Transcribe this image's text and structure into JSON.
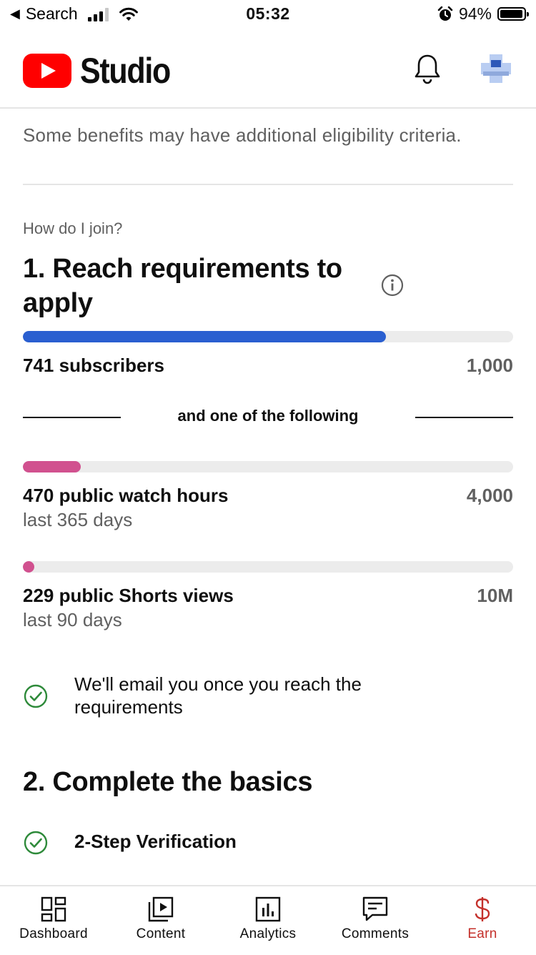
{
  "status_bar": {
    "back_label": "Search",
    "time": "05:32",
    "battery": "94%"
  },
  "app": {
    "name": "Studio"
  },
  "colors": {
    "brand_red": "#ff0000",
    "subscriber_bar": "#2a5fd0",
    "watch_bar": "#d1518f",
    "shorts_bar": "#d1518f",
    "check_green": "#2e8a3a",
    "active_tab": "#c4302b"
  },
  "content": {
    "eligibility_note": "Some benefits may have additional eligibility criteria.",
    "how_join": "How do I join?",
    "step1_title": "1. Reach requirements to apply",
    "subscribers": {
      "label": "741 subscribers",
      "target": "1,000",
      "progress": 0.741
    },
    "divider_text": "and one of the following",
    "watch_hours": {
      "label": "470 public watch hours",
      "period": "last 365 days",
      "target": "4,000",
      "progress": 0.1175
    },
    "shorts_views": {
      "label": "229 public Shorts views",
      "period": "last 90 days",
      "target": "10M",
      "progress": 2.29e-05
    },
    "email_note": "We'll email you once you reach the requirements",
    "step2_title": "2. Complete the basics",
    "two_step": "2-Step Verification"
  },
  "tabs": [
    {
      "label": "Dashboard",
      "icon": "dashboard-icon"
    },
    {
      "label": "Content",
      "icon": "content-icon"
    },
    {
      "label": "Analytics",
      "icon": "analytics-icon"
    },
    {
      "label": "Comments",
      "icon": "comments-icon"
    },
    {
      "label": "Earn",
      "icon": "earn-icon",
      "active": true
    }
  ]
}
